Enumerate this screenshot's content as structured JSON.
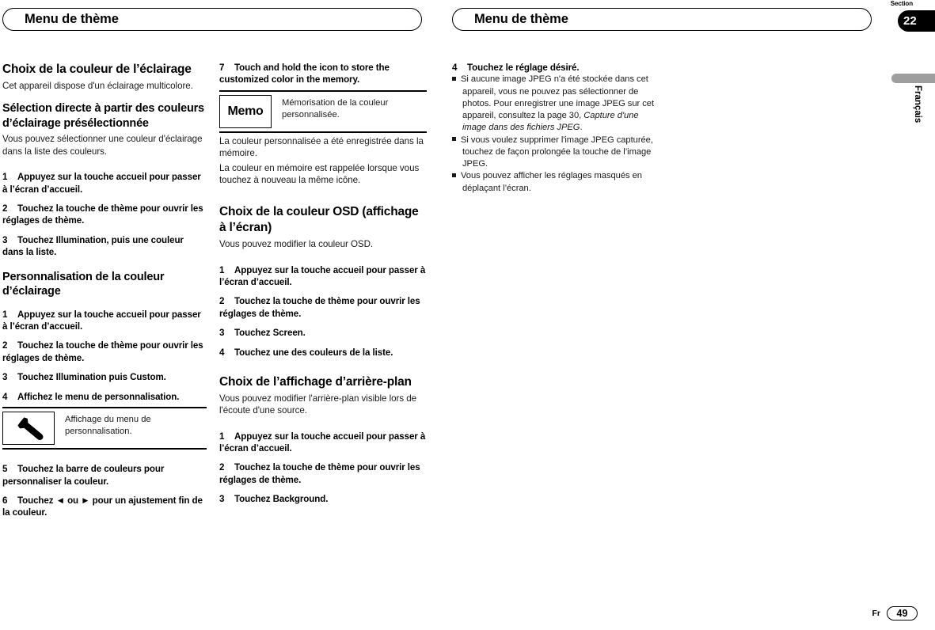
{
  "headers": {
    "left": "Menu de thème",
    "right": "Menu de thème"
  },
  "section_tab": {
    "label": "Section",
    "number": "22"
  },
  "language_tab": {
    "text": "Français"
  },
  "footer": {
    "lang_code": "Fr",
    "page_number": "49"
  },
  "column1": {
    "heading1": "Choix de la couleur de l’éclairage",
    "intro1": "Cet appareil dispose d'un éclairage multicolore.",
    "heading2": "Sélection directe à partir des couleurs d’éclairage présélectionnée",
    "intro2": "Vous pouvez sélectionner une couleur d'éclairage dans la liste des couleurs.",
    "steps_a": [
      {
        "n": "1",
        "text": "Appuyez sur la touche accueil pour passer à l’écran d’accueil."
      },
      {
        "n": "2",
        "text": "Touchez la touche de thème pour ouvrir les réglages de thème."
      },
      {
        "n": "3",
        "text": "Touchez Illumination, puis une couleur dans la liste."
      }
    ],
    "heading3": "Personnalisation de la couleur d’éclairage",
    "steps_b": [
      {
        "n": "1",
        "text": "Appuyez sur la touche accueil pour passer à l’écran d’accueil."
      },
      {
        "n": "2",
        "text": "Touchez la touche de thème pour ouvrir les réglages de thème."
      },
      {
        "n": "3",
        "text": "Touchez Illumination puis Custom."
      },
      {
        "n": "4",
        "text": "Affichez le menu de personnalisation."
      }
    ],
    "icon_note": {
      "icon": "wrench-icon",
      "description": "Affichage du menu de personnalisation."
    },
    "steps_c": [
      {
        "n": "5",
        "text": "Touchez la barre de couleurs pour personnaliser la couleur."
      },
      {
        "n": "6",
        "text": "Touchez ◄ ou ► pour un ajustement fin de la couleur."
      }
    ]
  },
  "column2": {
    "step7": {
      "n": "7",
      "text": "Touch and hold the icon to store the customized color in the memory."
    },
    "icon_note": {
      "icon": "memo-label",
      "icon_label": "Memo",
      "description": "Mémorisation de la couleur personnalisée."
    },
    "note_lines": [
      "La couleur personnalisée a été enregistrée dans la mémoire.",
      "La couleur en mémoire est rappelée lorsque vous touchez à nouveau la même icône."
    ],
    "heading1": "Choix de la couleur OSD (affichage à l’écran)",
    "intro1": "Vous pouvez modifier la couleur OSD.",
    "steps_a": [
      {
        "n": "1",
        "text": "Appuyez sur la touche accueil pour passer à l’écran d’accueil."
      },
      {
        "n": "2",
        "text": "Touchez la touche de thème pour ouvrir les réglages de thème."
      },
      {
        "n": "3",
        "text": "Touchez Screen."
      },
      {
        "n": "4",
        "text": "Touchez une des couleurs de la liste."
      }
    ],
    "heading2": "Choix de l’affichage d’arrière-plan",
    "intro2": "Vous pouvez modifier l'arrière-plan visible lors de l'écoute d'une source.",
    "steps_b": [
      {
        "n": "1",
        "text": "Appuyez sur la touche accueil pour passer à l’écran d’accueil."
      },
      {
        "n": "2",
        "text": "Touchez la touche de thème pour ouvrir les réglages de thème."
      },
      {
        "n": "3",
        "text": "Touchez Background."
      }
    ]
  },
  "column3": {
    "step4": {
      "n": "4",
      "text": "Touchez le réglage désiré."
    },
    "bullets": [
      {
        "pre": "Si aucune image JPEG n'a été stockée dans cet appareil, vous ne pouvez pas sélectionner de photos. Pour enregistrer une image JPEG sur cet appareil, consultez la page 30, ",
        "italic": "Capture d'une image dans des fichiers JPEG",
        "post": "."
      },
      {
        "pre": "Si vous voulez supprimer l'image JPEG capturée, touchez de façon prolongée la touche de l’image JPEG.",
        "italic": "",
        "post": ""
      },
      {
        "pre": "Vous pouvez afficher les réglages masqués en déplaçant l’écran.",
        "italic": "",
        "post": ""
      }
    ]
  }
}
